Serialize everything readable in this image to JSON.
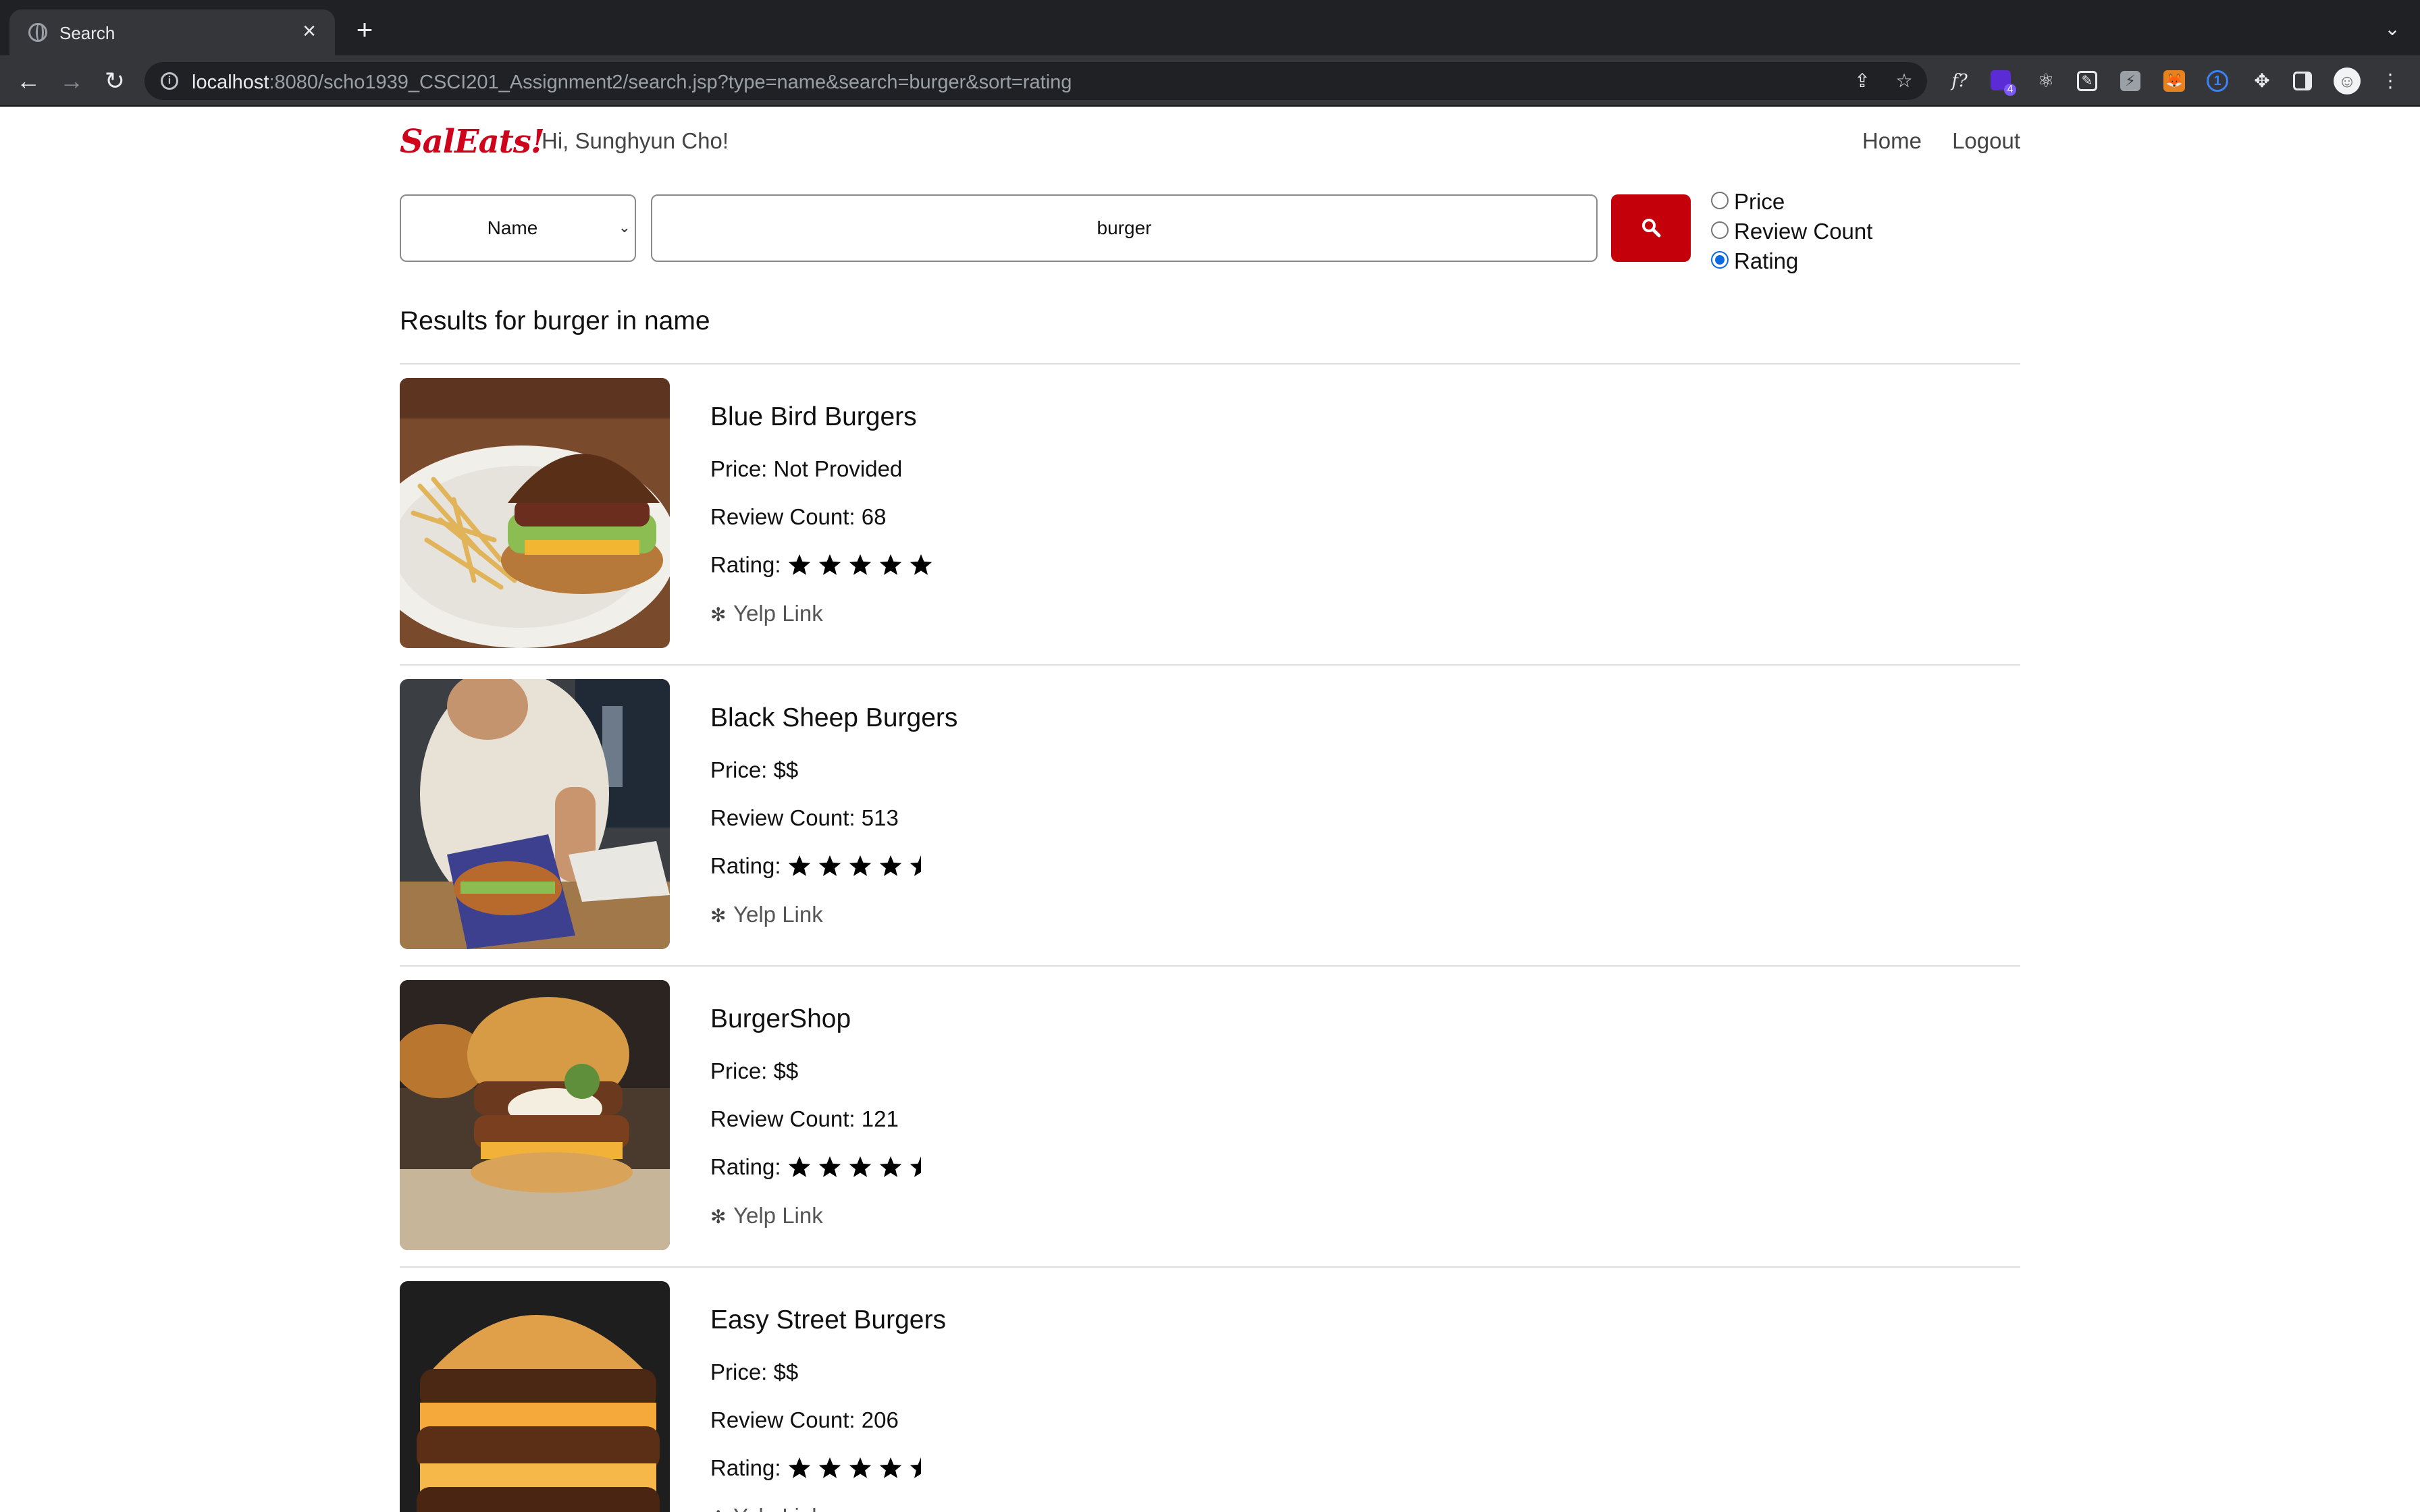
{
  "browser": {
    "tab_title": "Search",
    "url_host": "localhost",
    "url_rest": ":8080/scho1939_CSCI201_Assignment2/search.jsp?type=name&search=burger&sort=rating",
    "extension_badge": "4"
  },
  "header": {
    "logo": "SalEats!",
    "greeting": "Hi, Sunghyun Cho!",
    "nav_home": "Home",
    "nav_logout": "Logout"
  },
  "search": {
    "type_selected": "Name",
    "query": "burger",
    "sort_options": [
      "Price",
      "Review Count",
      "Rating"
    ],
    "sort_selected": "Rating"
  },
  "results": {
    "heading": "Results for burger in name",
    "items": [
      {
        "name": "Blue Bird Burgers",
        "price": "Price: Not Provided",
        "reviews": "Review Count: 68",
        "rating_label": "Rating:",
        "rating": 5,
        "yelp": "Yelp Link"
      },
      {
        "name": "Black Sheep Burgers",
        "price": "Price: $$",
        "reviews": "Review Count: 513",
        "rating_label": "Rating:",
        "rating": 4.5,
        "yelp": "Yelp Link"
      },
      {
        "name": "BurgerShop",
        "price": "Price: $$",
        "reviews": "Review Count: 121",
        "rating_label": "Rating:",
        "rating": 4.5,
        "yelp": "Yelp Link"
      },
      {
        "name": "Easy Street Burgers",
        "price": "Price: $$",
        "reviews": "Review Count: 206",
        "rating_label": "Rating:",
        "rating": 4.5,
        "yelp": "Yelp Link"
      }
    ]
  },
  "colors": {
    "brand": "#d0021b",
    "search_button": "#c4000a",
    "radio_checked": "#0b6bde"
  }
}
